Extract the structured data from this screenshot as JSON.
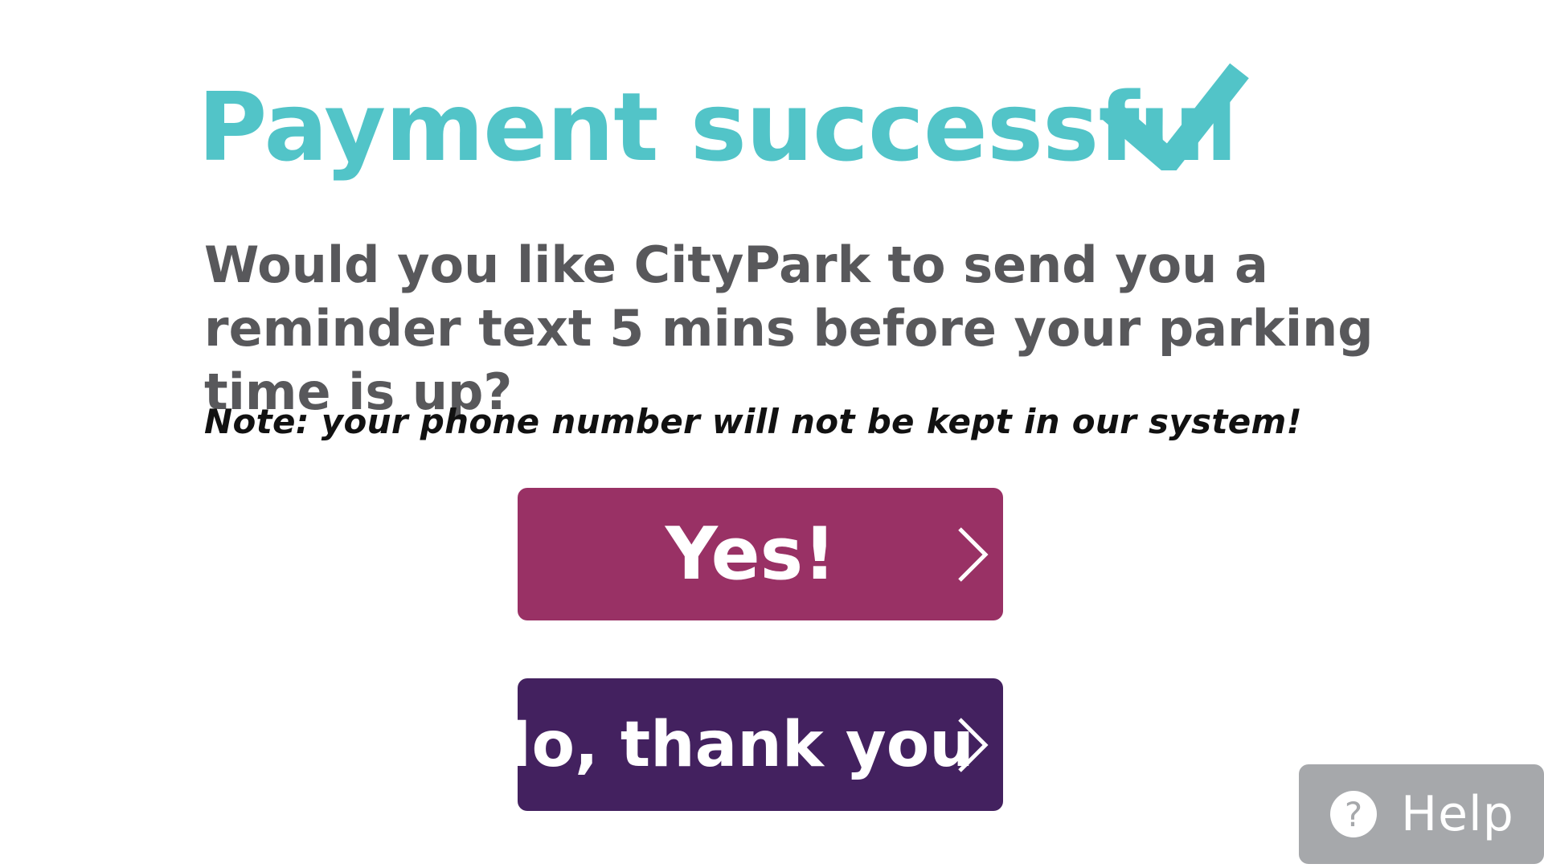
{
  "header": {
    "title": "Payment successful",
    "check_icon": "checkmark-icon",
    "title_color": "#52c4c8"
  },
  "prompt": {
    "question": "Would you like CityPark to send you a reminder text 5 mins before your parking time is up?",
    "note": "Note: your phone number will not be kept in our system!"
  },
  "actions": {
    "yes_label": "Yes!",
    "yes_color": "#993165",
    "no_label": "No, thank you",
    "no_color": "#43215f",
    "chevron_icon": "chevron-right-icon"
  },
  "help": {
    "label": "Help",
    "icon_glyph": "?",
    "icon": "question-circle-icon",
    "color": "#a6a8ab"
  }
}
